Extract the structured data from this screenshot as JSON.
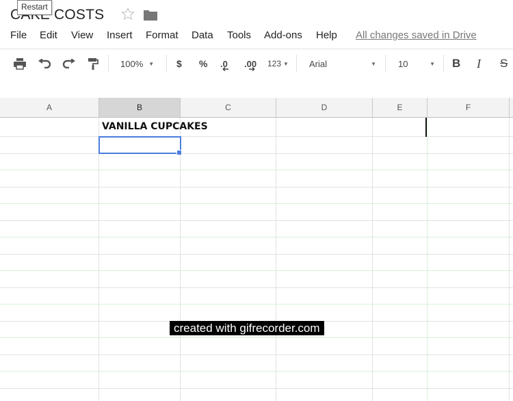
{
  "doc": {
    "title": "CAKE COSTS",
    "tooltip": "Restart"
  },
  "menu": {
    "items": [
      "File",
      "Edit",
      "View",
      "Insert",
      "Format",
      "Data",
      "Tools",
      "Add-ons",
      "Help"
    ],
    "saved_status": "All changes saved in Drive"
  },
  "toolbar": {
    "zoom": "100%",
    "currency": "$",
    "percent": "%",
    "decrease_decimals": ".0",
    "increase_decimals": ".00",
    "more_formats": "123",
    "font": "Arial",
    "font_size": "10",
    "bold": "B",
    "italic": "I",
    "strikethrough": "S"
  },
  "sheet": {
    "columns": [
      "A",
      "B",
      "C",
      "D",
      "E",
      "F"
    ],
    "active_column": "B",
    "cell_b1": "VANILLA CUPCAKES"
  },
  "watermark": "created with gifrecorder.com",
  "colors": {
    "selection": "#4a7de0",
    "header_bg": "#f3f3f3",
    "active_header_bg": "#d6d6d6"
  }
}
